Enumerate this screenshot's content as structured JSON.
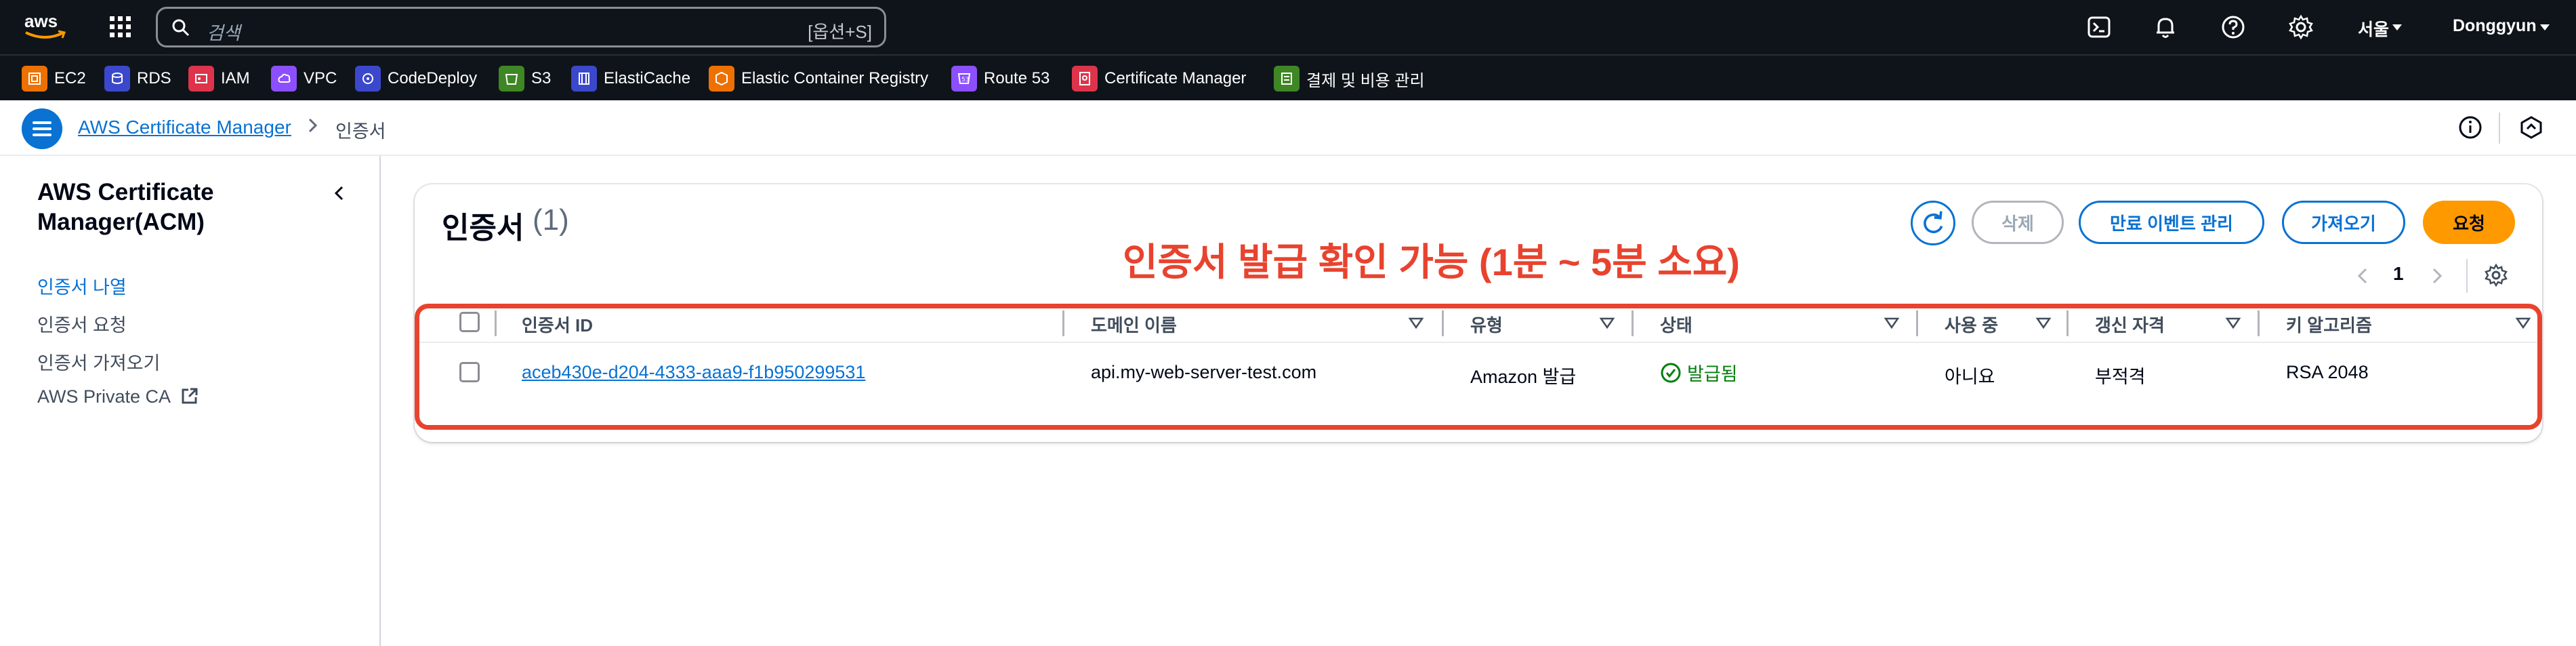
{
  "topnav": {
    "logo_text": "aws",
    "search_placeholder": "검색",
    "search_shortcut": "[옵션+S]",
    "region": "서울",
    "user": "Donggyun"
  },
  "favorites": [
    {
      "label": "EC2",
      "color": "#ed7100"
    },
    {
      "label": "RDS",
      "color": "#3b48cc"
    },
    {
      "label": "IAM",
      "color": "#dd344c"
    },
    {
      "label": "VPC",
      "color": "#8c4fff"
    },
    {
      "label": "CodeDeploy",
      "color": "#3b48cc"
    },
    {
      "label": "S3",
      "color": "#3f8624"
    },
    {
      "label": "ElastiCache",
      "color": "#3b48cc"
    },
    {
      "label": "Elastic Container Registry",
      "color": "#ed7100"
    },
    {
      "label": "Route 53",
      "color": "#8c4fff"
    },
    {
      "label": "Certificate Manager",
      "color": "#dd344c"
    },
    {
      "label": "결제 및 비용 관리",
      "color": "#3f8624"
    }
  ],
  "breadcrumb": {
    "parent": "AWS Certificate Manager",
    "current": "인증서"
  },
  "sidenav": {
    "title": "AWS Certificate Manager(ACM)",
    "items": [
      {
        "label": "인증서 나열",
        "active": true
      },
      {
        "label": "인증서 요청",
        "active": false
      },
      {
        "label": "인증서 가져오기",
        "active": false
      },
      {
        "label": "AWS Private CA",
        "active": false,
        "external": true
      }
    ]
  },
  "panel": {
    "title": "인증서",
    "count": "(1)",
    "buttons": {
      "delete": "삭제",
      "manage_expiry": "만료 이벤트 관리",
      "import": "가져오기",
      "request": "요청"
    },
    "page_number": "1",
    "annotation": "인증서 발급 확인 가능 (1분 ~ 5분 소요)"
  },
  "table": {
    "columns": [
      "인증서 ID",
      "도메인 이름",
      "유형",
      "상태",
      "사용 중",
      "갱신 자격",
      "키 알고리즘"
    ],
    "rows": [
      {
        "id": "aceb430e-d204-4333-aaa9-f1b950299531",
        "domain": "api.my-web-server-test.com",
        "type": "Amazon 발급",
        "status": "발급됨",
        "in_use": "아니요",
        "renewal": "부적격",
        "key_algorithm": "RSA 2048"
      }
    ]
  },
  "colors": {
    "accent": "#0972d3",
    "primary_button": "#ff9900",
    "annotation": "#e8432e",
    "success": "#037f0c",
    "nav_bg": "#0f141a"
  }
}
